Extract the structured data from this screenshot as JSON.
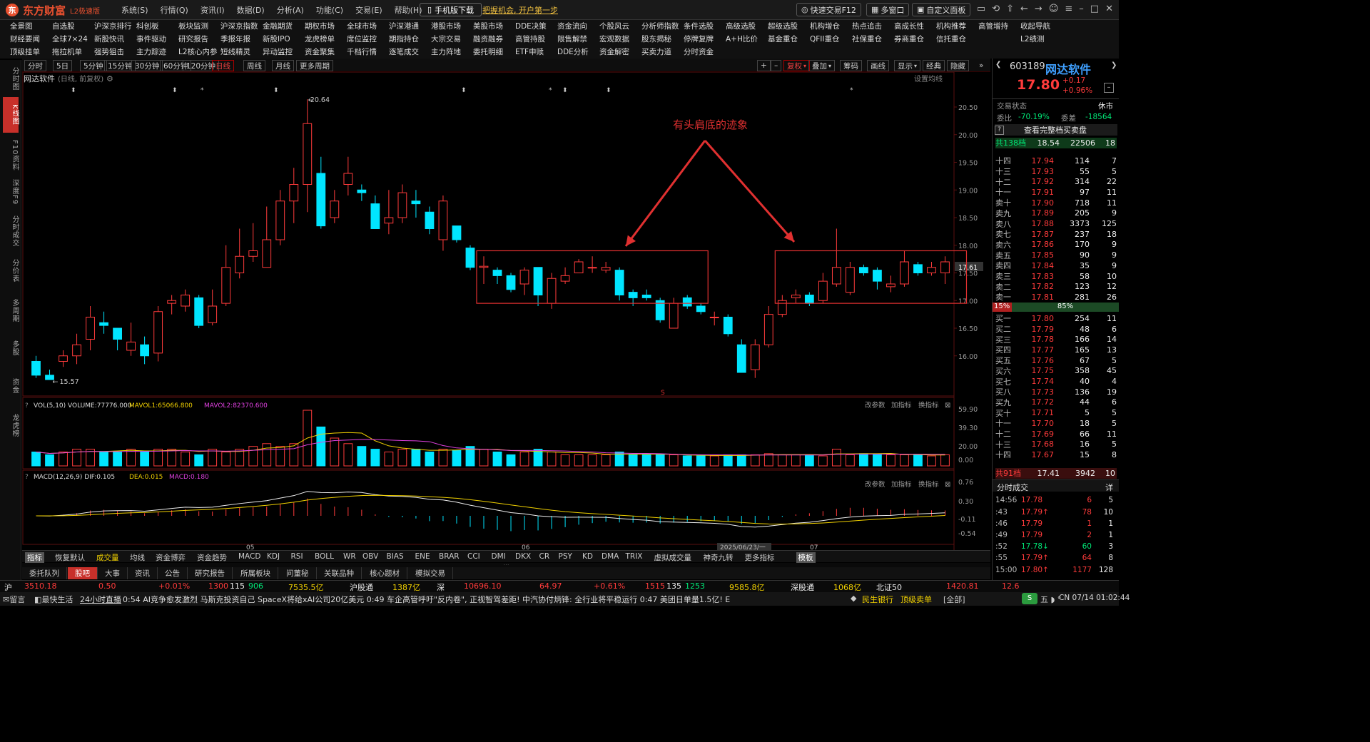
{
  "app": {
    "name": "东方财富",
    "edition": "L2极速版",
    "logo_glyph": "东"
  },
  "menu": [
    "系统(S)",
    "行情(Q)",
    "资讯(I)",
    "数据(D)",
    "分析(A)",
    "功能(C)",
    "交易(E)",
    "帮助(H)"
  ],
  "titlebar": {
    "mobile_download": "手机版下载",
    "promo": "把握机会, 开户第一步",
    "quick_trade": "快速交易F12",
    "multi_window": "多窗口",
    "custom_panel": "自定义面板"
  },
  "nav": {
    "row1": [
      "全景图",
      "自选股",
      "沪深京排行",
      "科创板",
      "板块监测",
      "沪深京指数",
      "金融期货",
      "期权市场",
      "全球市场",
      "沪深港通",
      "港股市场",
      "美股市场",
      "DDE决策",
      "资金流向",
      "个股风云",
      "分析师指数",
      "条件选股",
      "高级选股",
      "超级选股",
      "机构增仓",
      "热点追击",
      "高成长性",
      "机构推荐",
      "高管增持",
      "收起导航"
    ],
    "row2": [
      "财经要闻",
      "全球7×24",
      "新股快讯",
      "事件驱动",
      "研究报告",
      "季报年报",
      "新股IPO",
      "龙虎榜单",
      "席位监控",
      "期指持仓",
      "大宗交易",
      "融资融券",
      "高管持股",
      "限售解禁",
      "宏观数据",
      "股东揭秘",
      "停牌复牌",
      "A+H比价",
      "基金重仓",
      "QFII重仓",
      "社保重仓",
      "券商重仓",
      "信托重仓",
      "",
      "L2绩测"
    ],
    "row3": [
      "顶级挂单",
      "拖拉机单",
      "强势狙击",
      "主力踪迹",
      "L2核心内参",
      "短线精灵",
      "异动监控",
      "资金聚集",
      "千档行情",
      "逐笔成交",
      "主力阵地",
      "委托明细",
      "ETF申赎",
      "DDE分析",
      "资金解密",
      "买卖力道",
      "分时资金"
    ]
  },
  "left_tabs": [
    "分时图",
    "K线图",
    "F10资料",
    "深度F9",
    "分时成交",
    "分价表",
    "多周期",
    "多股",
    "资金",
    "龙虎榜"
  ],
  "periods": [
    "分时",
    "5日",
    "5分钟",
    "15分钟",
    "30分钟",
    "60分钟",
    "120分钟",
    "日线",
    "周线",
    "月线",
    "更多周期"
  ],
  "chart_tools": [
    "复权",
    "叠加",
    "筹码",
    "画线",
    "显示",
    "经典",
    "隐藏"
  ],
  "chart_header": {
    "stock_name": "网达软件",
    "mode": "(日线, 前复权)",
    "ma_setting": "设置均线"
  },
  "annotation": {
    "text": "有头肩底的迹象"
  },
  "marks": {
    "high_label": "20.64",
    "low_label": "15.57",
    "last_price_tag": "17.61"
  },
  "chart_data": {
    "type": "candlestick",
    "ylim": [
      15.3,
      20.9
    ],
    "y_ticks": [
      20.5,
      20.0,
      19.5,
      19.0,
      18.5,
      18.0,
      17.5,
      17.0,
      16.5,
      16.0
    ],
    "x_labels": [
      "05",
      "06",
      "2025/06/23/一",
      "07"
    ],
    "candles": [
      [
        15.9,
        15.65,
        16.0,
        15.6
      ],
      [
        15.65,
        15.57,
        15.75,
        15.57
      ],
      [
        15.9,
        16.0,
        16.1,
        15.8
      ],
      [
        16.0,
        16.2,
        16.4,
        15.85
      ],
      [
        16.3,
        16.7,
        16.9,
        16.1
      ],
      [
        16.6,
        16.55,
        16.8,
        16.4
      ],
      [
        16.5,
        16.3,
        16.5,
        16.1
      ],
      [
        16.1,
        16.25,
        16.6,
        16.0
      ],
      [
        16.2,
        16.0,
        16.35,
        15.85
      ],
      [
        16.05,
        16.8,
        16.9,
        15.9
      ],
      [
        16.95,
        17.0,
        17.1,
        16.75
      ],
      [
        16.9,
        17.1,
        17.2,
        16.8
      ],
      [
        17.05,
        16.55,
        17.1,
        16.5
      ],
      [
        16.6,
        16.9,
        17.2,
        16.55
      ],
      [
        16.95,
        17.6,
        18.0,
        16.9
      ],
      [
        17.5,
        17.8,
        18.3,
        17.4
      ],
      [
        17.8,
        17.9,
        18.4,
        17.7
      ],
      [
        17.6,
        18.1,
        18.7,
        17.6
      ],
      [
        18.1,
        18.8,
        19.0,
        18.0
      ],
      [
        18.8,
        19.1,
        19.4,
        18.4
      ],
      [
        19.1,
        20.2,
        20.64,
        18.6
      ],
      [
        19.3,
        18.35,
        19.6,
        18.3
      ],
      [
        18.5,
        18.8,
        19.0,
        18.4
      ],
      [
        19.1,
        19.3,
        19.6,
        18.9
      ],
      [
        19.0,
        18.95,
        19.1,
        18.8
      ],
      [
        18.75,
        18.3,
        18.9,
        18.3
      ],
      [
        18.4,
        18.5,
        19.0,
        18.2
      ],
      [
        18.5,
        18.95,
        19.1,
        18.4
      ],
      [
        18.8,
        18.75,
        19.0,
        18.5
      ],
      [
        18.6,
        18.3,
        18.7,
        18.2
      ],
      [
        18.1,
        18.8,
        18.9,
        17.9
      ],
      [
        18.35,
        18.1,
        18.35,
        18.05
      ],
      [
        17.95,
        17.6,
        18.0,
        17.55
      ],
      [
        17.6,
        17.62,
        17.8,
        17.3
      ],
      [
        17.55,
        17.45,
        17.6,
        17.3
      ],
      [
        17.45,
        17.2,
        17.5,
        17.15
      ],
      [
        17.3,
        17.55,
        17.6,
        17.1
      ],
      [
        17.6,
        17.1,
        17.6,
        16.9
      ],
      [
        16.95,
        17.4,
        17.5,
        16.85
      ],
      [
        17.35,
        17.45,
        17.6,
        17.3
      ],
      [
        17.5,
        17.7,
        17.75,
        17.5
      ],
      [
        17.6,
        17.6,
        17.8,
        17.5
      ],
      [
        17.55,
        17.6,
        17.7,
        17.5
      ],
      [
        17.55,
        17.1,
        17.6,
        17.0
      ],
      [
        17.15,
        17.05,
        17.2,
        16.9
      ],
      [
        17.1,
        17.05,
        17.2,
        17.0
      ],
      [
        17.0,
        16.65,
        17.05,
        16.6
      ],
      [
        16.5,
        16.95,
        17.05,
        16.5
      ],
      [
        17.05,
        16.9,
        17.1,
        16.85
      ],
      [
        16.9,
        16.8,
        16.95,
        16.75
      ],
      [
        16.7,
        16.7,
        16.8,
        16.55
      ],
      [
        16.7,
        16.4,
        16.75,
        16.35
      ],
      [
        16.2,
        15.7,
        16.3,
        15.7
      ],
      [
        15.75,
        16.2,
        16.3,
        15.6
      ],
      [
        16.2,
        16.75,
        16.9,
        16.15
      ],
      [
        16.75,
        17.0,
        17.1,
        16.7
      ],
      [
        17.05,
        17.1,
        17.2,
        16.95
      ],
      [
        17.1,
        16.95,
        17.15,
        16.9
      ],
      [
        17.0,
        17.35,
        17.5,
        16.95
      ],
      [
        17.3,
        17.6,
        18.3,
        17.25
      ],
      [
        17.15,
        17.6,
        17.7,
        17.1
      ],
      [
        17.6,
        17.5,
        17.65,
        17.45
      ],
      [
        17.55,
        17.35,
        17.6,
        17.2
      ],
      [
        17.25,
        17.3,
        17.45,
        17.15
      ],
      [
        17.3,
        17.7,
        17.9,
        17.25
      ],
      [
        17.65,
        17.5,
        17.7,
        17.45
      ],
      [
        17.5,
        17.6,
        17.7,
        17.45
      ],
      [
        17.5,
        17.7,
        17.8,
        17.3
      ]
    ],
    "volume": [
      0.25,
      0.2,
      0.25,
      0.3,
      0.3,
      0.25,
      0.25,
      0.3,
      0.25,
      0.3,
      0.3,
      0.25,
      0.2,
      0.3,
      0.25,
      0.3,
      0.35,
      0.4,
      0.35,
      0.4,
      1.0,
      0.7,
      0.5,
      0.4,
      0.35,
      0.3,
      0.25,
      0.3,
      0.3,
      0.25,
      0.3,
      0.28,
      0.35,
      0.3,
      0.25,
      0.2,
      0.25,
      0.3,
      0.25,
      0.2,
      0.2,
      0.2,
      0.2,
      0.25,
      0.2,
      0.2,
      0.2,
      0.2,
      0.18,
      0.18,
      0.18,
      0.2,
      0.2,
      0.2,
      0.22,
      0.2,
      0.2,
      0.2,
      0.18,
      0.3,
      0.2,
      0.22,
      0.2,
      0.2,
      0.2,
      0.2,
      0.18,
      0.2
    ],
    "volume_ticks": [
      "59.90",
      "39.30",
      "20.00",
      "0.00"
    ],
    "macd_ticks": [
      "0.76",
      "0.30",
      "-0.11",
      "-0.54"
    ],
    "vol_legend": "VOL(5,10)  VOLUME:77776.000",
    "vol_ma1": "MAVOL1:65066.800",
    "vol_ma2": "MAVOL2:82370.600",
    "macd_legend": "MACD(12,26,9)  DIF:0.105",
    "macd_dea": "DEA:0.015",
    "macd_val": "MACD:0.180"
  },
  "pane_buttons": [
    "改参数",
    "加指标",
    "换指标"
  ],
  "indicators": [
    "指标",
    "恢复默认",
    "成交量",
    "均线",
    "资金博弈",
    "资金趋势",
    "MACD",
    "KDJ",
    "RSI",
    "BOLL",
    "WR",
    "OBV",
    "BIAS",
    "ENE",
    "BRAR",
    "CCI",
    "DMI",
    "DKX",
    "CR",
    "PSY",
    "KD",
    "DMA",
    "TRIX",
    "虚拟成交量",
    "神奇九转",
    "更多指标",
    "模板"
  ],
  "bottom_tabs": [
    "委托队列",
    "股吧",
    "大事",
    "资讯",
    "公告",
    "研究报告",
    "所属板块",
    "问董秘",
    "关联品种",
    "核心题材",
    "模拟交易"
  ],
  "quote": {
    "code": "603189",
    "name": "网达软件",
    "price": "17.80",
    "change": "+0.17",
    "change_pct": "+0.96%",
    "status_label": "交易状态",
    "status": "休市",
    "weibi_label": "委比",
    "weibi": "-70.19%",
    "weicha_label": "委差",
    "weicha": "-18564",
    "full_book": "查看完整档买卖盘",
    "ask_total": {
      "label": "共138档",
      "price": "18.54",
      "vol": "22506",
      "n": "18"
    },
    "bid_total": {
      "label": "共91档",
      "price": "17.41",
      "vol": "3942",
      "n": "10"
    },
    "ratio": {
      "left": "15%",
      "right": "85%"
    }
  },
  "asks": [
    {
      "l": "十四",
      "p": "17.94",
      "v": "114",
      "c": "7"
    },
    {
      "l": "十三",
      "p": "17.93",
      "v": "55",
      "c": "5"
    },
    {
      "l": "十二",
      "p": "17.92",
      "v": "314",
      "c": "22"
    },
    {
      "l": "十一",
      "p": "17.91",
      "v": "97",
      "c": "11"
    },
    {
      "l": "卖十",
      "p": "17.90",
      "v": "718",
      "c": "11"
    },
    {
      "l": "卖九",
      "p": "17.89",
      "v": "205",
      "c": "9"
    },
    {
      "l": "卖八",
      "p": "17.88",
      "v": "3373",
      "c": "125"
    },
    {
      "l": "卖七",
      "p": "17.87",
      "v": "237",
      "c": "18"
    },
    {
      "l": "卖六",
      "p": "17.86",
      "v": "170",
      "c": "9"
    },
    {
      "l": "卖五",
      "p": "17.85",
      "v": "90",
      "c": "9"
    },
    {
      "l": "卖四",
      "p": "17.84",
      "v": "35",
      "c": "9"
    },
    {
      "l": "卖三",
      "p": "17.83",
      "v": "58",
      "c": "10"
    },
    {
      "l": "卖二",
      "p": "17.82",
      "v": "123",
      "c": "12"
    },
    {
      "l": "卖一",
      "p": "17.81",
      "v": "281",
      "c": "26"
    }
  ],
  "bids": [
    {
      "l": "买一",
      "p": "17.80",
      "v": "254",
      "c": "11"
    },
    {
      "l": "买二",
      "p": "17.79",
      "v": "48",
      "c": "6"
    },
    {
      "l": "买三",
      "p": "17.78",
      "v": "166",
      "c": "14"
    },
    {
      "l": "买四",
      "p": "17.77",
      "v": "165",
      "c": "13"
    },
    {
      "l": "买五",
      "p": "17.76",
      "v": "67",
      "c": "5"
    },
    {
      "l": "买六",
      "p": "17.75",
      "v": "358",
      "c": "45"
    },
    {
      "l": "买七",
      "p": "17.74",
      "v": "40",
      "c": "4"
    },
    {
      "l": "买八",
      "p": "17.73",
      "v": "136",
      "c": "19"
    },
    {
      "l": "买九",
      "p": "17.72",
      "v": "44",
      "c": "6"
    },
    {
      "l": "买十",
      "p": "17.71",
      "v": "5",
      "c": "5"
    },
    {
      "l": "十一",
      "p": "17.70",
      "v": "18",
      "c": "5"
    },
    {
      "l": "十二",
      "p": "17.69",
      "v": "66",
      "c": "11"
    },
    {
      "l": "十三",
      "p": "17.68",
      "v": "16",
      "c": "5"
    },
    {
      "l": "十四",
      "p": "17.67",
      "v": "15",
      "c": "8"
    }
  ],
  "trades_title": "分时成交",
  "trades_detail": "详",
  "trades": [
    {
      "t": "14:56",
      "p": "17.78",
      "v": "6",
      "n": "5",
      "c": "red"
    },
    {
      "t": ":43",
      "p": "17.79↑",
      "v": "78",
      "n": "10",
      "c": "red"
    },
    {
      "t": ":46",
      "p": "17.79",
      "v": "1",
      "n": "1",
      "c": "red"
    },
    {
      "t": ":49",
      "p": "17.79",
      "v": "2",
      "n": "1",
      "c": "red"
    },
    {
      "t": ":52",
      "p": "17.78↓",
      "v": "60",
      "n": "3",
      "c": "green"
    },
    {
      "t": ":55",
      "p": "17.79↑",
      "v": "64",
      "n": "8",
      "c": "red"
    },
    {
      "t": "15:00",
      "p": "17.80↑",
      "v": "1177",
      "n": "128",
      "c": "red"
    }
  ],
  "indexbar": {
    "sh_label": "沪",
    "sh": "3510.18",
    "sh_chg": "0.50",
    "sh_pct": "+0.01%",
    "sh_up": "1300",
    "sh_flat": "115",
    "sh_down": "906",
    "sh_amt": "7535.5亿",
    "hgt_label": "沪股通",
    "hgt": "1387亿",
    "sz_label": "深",
    "sz": "10696.10",
    "sz_chg": "64.97",
    "sz_pct": "+0.61%",
    "sz_up": "1515",
    "sz_flat": "135",
    "sz_down": "1253",
    "sz_amt": "9585.8亿",
    "sgt_label": "深股通",
    "sgt": "1068亿",
    "bz_label": "北证50",
    "bz": "1420.81",
    "extra": "12.6"
  },
  "newsbar": {
    "msg_label": "留言",
    "hotline": "最快生活",
    "live": "24小时直播",
    "items": "0:54  AI竞争愈发激烈  马斯克投资自己 SpaceX将给xAI公司20亿美元   0:49  车企高管呼吁\"反内卷\", 正视智驾差距! 中汽协付炳锋: 全行业将平稳运行   0:47  美团日单量1.5亿! E",
    "ticker": "民生银行",
    "ticker_tag": "顶级卖单",
    "all": "[全部]",
    "clock": "CN 07/14 01:02:44"
  }
}
